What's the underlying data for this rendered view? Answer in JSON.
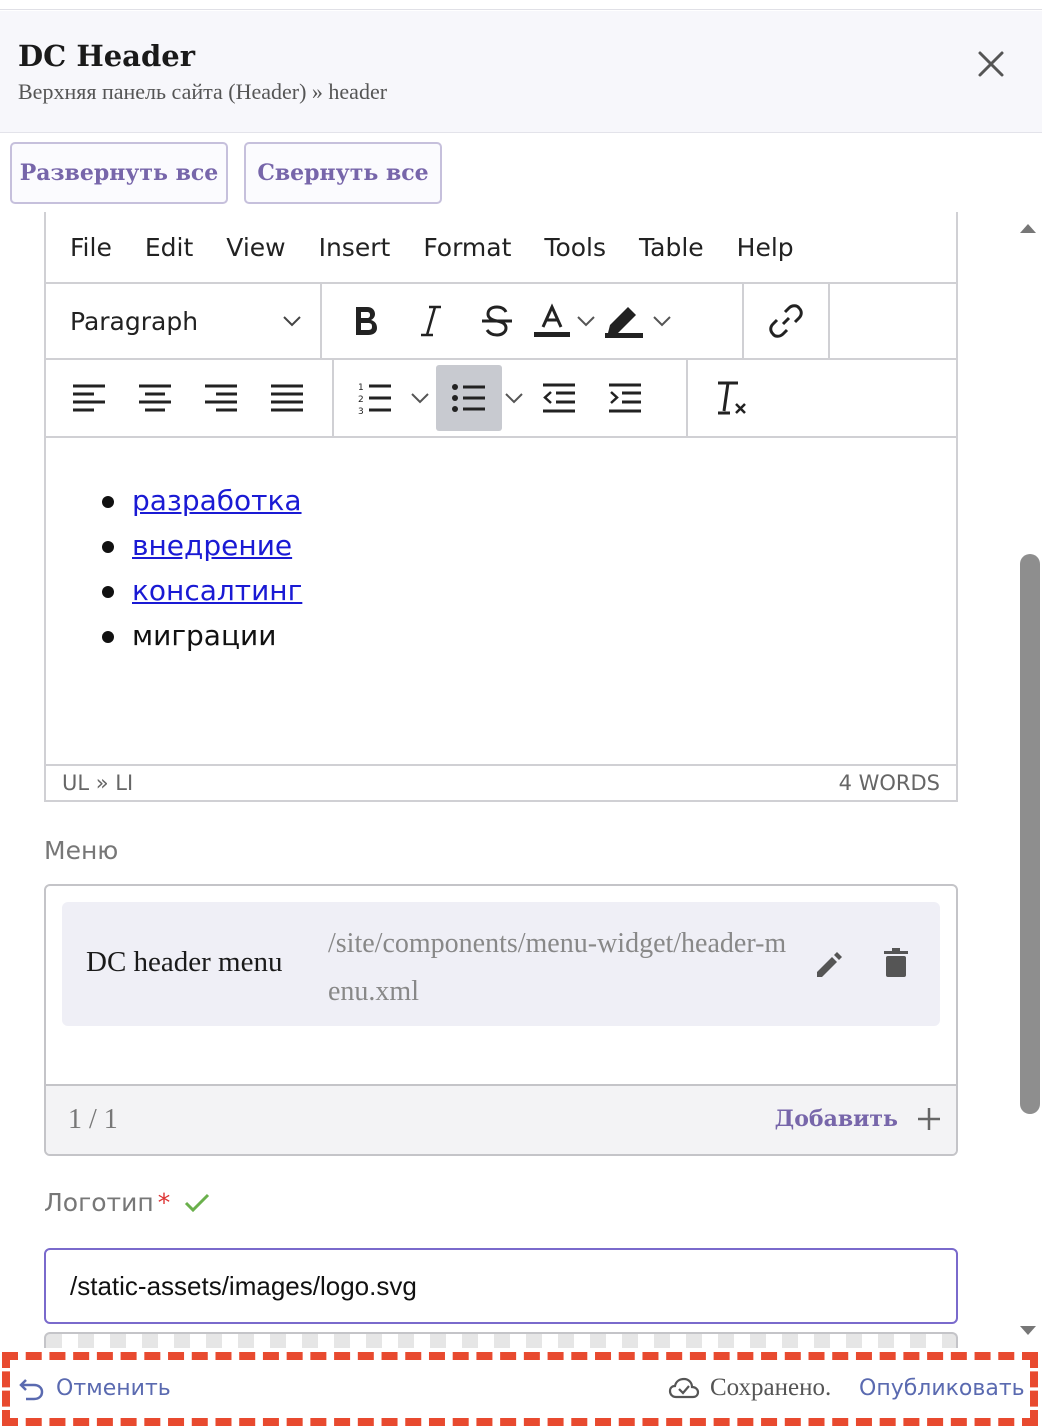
{
  "header": {
    "title": "DC Header",
    "subtitle": "Верхняя панель сайта (Header) » header"
  },
  "actions": {
    "expand_all": "Развернуть все",
    "collapse_all": "Свернуть все"
  },
  "editor": {
    "menubar": [
      "File",
      "Edit",
      "View",
      "Insert",
      "Format",
      "Tools",
      "Table",
      "Help"
    ],
    "block_format": "Paragraph",
    "list_items": [
      {
        "text": "разработка",
        "link": true
      },
      {
        "text": "внедрение",
        "link": true
      },
      {
        "text": "консалтинг",
        "link": true
      },
      {
        "text": "миграции",
        "link": false
      }
    ],
    "path": "UL » LI",
    "word_count": "4 WORDS"
  },
  "menu_field": {
    "label": "Меню",
    "item_name": "DC header menu",
    "item_path": "/site/components/menu-widget/header-menu.xml",
    "count": "1 / 1",
    "add_label": "Добавить"
  },
  "logo_field": {
    "label": "Логотип",
    "required_mark": "*",
    "value": "/static-assets/images/logo.svg"
  },
  "footer": {
    "cancel_label": "Отменить",
    "saved_label": "Сохранено.",
    "publish_label": "Опубликовать"
  },
  "colors": {
    "accent": "#7766aa",
    "link": "#1a1ad4",
    "footer_dash": "#e84a2f",
    "input_focus": "#7a6acc",
    "valid_check": "#6ab04c"
  }
}
